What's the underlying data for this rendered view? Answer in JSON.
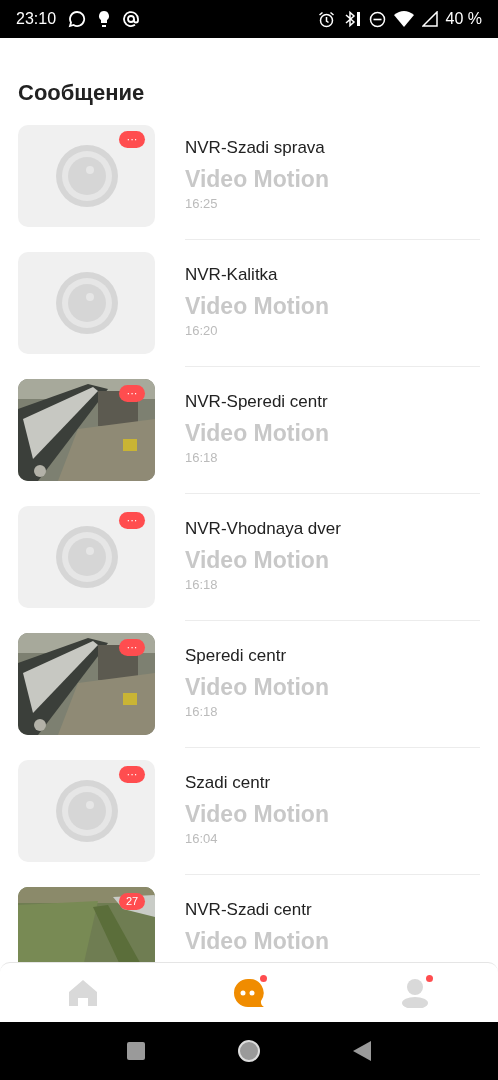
{
  "status_bar": {
    "time": "23:10",
    "battery": "40 %"
  },
  "title": "Сообщение",
  "messages": [
    {
      "device": "NVR-Szadi sprava",
      "event": "Video Motion",
      "time": "16:25",
      "thumbnail": {
        "kind": "placeholder"
      },
      "badge": "···"
    },
    {
      "device": "NVR-Kalitka",
      "event": "Video Motion",
      "time": "16:20",
      "thumbnail": {
        "kind": "placeholder"
      }
    },
    {
      "device": "NVR-Speredi centr",
      "event": "Video Motion",
      "time": "16:18",
      "badge": "···"
    },
    {
      "device": "NVR-Vhodnaya dver",
      "event": "Video Motion",
      "time": "16:18",
      "thumbnail": {
        "kind": "placeholder"
      },
      "badge": "···"
    },
    {
      "device": "Speredi centr",
      "event": "Video Motion",
      "time": "16:18",
      "badge": "···"
    },
    {
      "device": "Szadi centr",
      "event": "Video Motion",
      "time": "16:04",
      "thumbnail": {
        "kind": "placeholder"
      },
      "badge": "···"
    },
    {
      "device": "NVR-Szadi centr",
      "event": "Video Motion",
      "badge": "27"
    }
  ],
  "tabs": [
    {
      "kind": "home",
      "selected": false,
      "dot": false
    },
    {
      "kind": "messages",
      "selected": true,
      "dot": true
    },
    {
      "kind": "profile",
      "selected": false,
      "dot": true
    }
  ]
}
